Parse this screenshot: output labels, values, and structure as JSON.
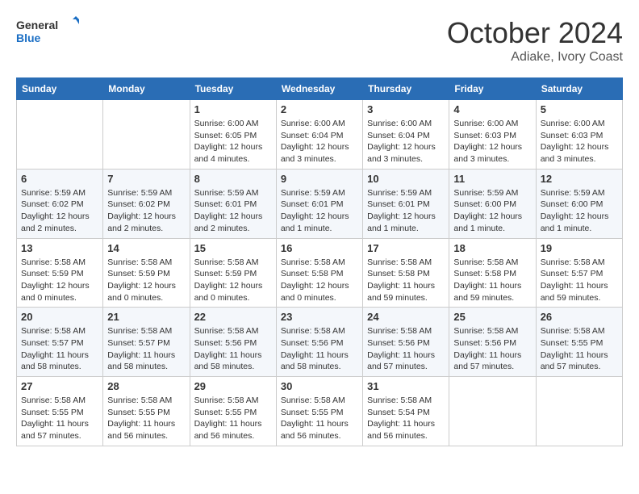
{
  "header": {
    "logo": "GeneralBlue",
    "month": "October 2024",
    "location": "Adiake, Ivory Coast"
  },
  "weekdays": [
    "Sunday",
    "Monday",
    "Tuesday",
    "Wednesday",
    "Thursday",
    "Friday",
    "Saturday"
  ],
  "weeks": [
    [
      null,
      null,
      {
        "day": 1,
        "sunrise": "6:00 AM",
        "sunset": "6:05 PM",
        "daylight": "12 hours and 4 minutes."
      },
      {
        "day": 2,
        "sunrise": "6:00 AM",
        "sunset": "6:04 PM",
        "daylight": "12 hours and 3 minutes."
      },
      {
        "day": 3,
        "sunrise": "6:00 AM",
        "sunset": "6:04 PM",
        "daylight": "12 hours and 3 minutes."
      },
      {
        "day": 4,
        "sunrise": "6:00 AM",
        "sunset": "6:03 PM",
        "daylight": "12 hours and 3 minutes."
      },
      {
        "day": 5,
        "sunrise": "6:00 AM",
        "sunset": "6:03 PM",
        "daylight": "12 hours and 3 minutes."
      }
    ],
    [
      {
        "day": 6,
        "sunrise": "5:59 AM",
        "sunset": "6:02 PM",
        "daylight": "12 hours and 2 minutes."
      },
      {
        "day": 7,
        "sunrise": "5:59 AM",
        "sunset": "6:02 PM",
        "daylight": "12 hours and 2 minutes."
      },
      {
        "day": 8,
        "sunrise": "5:59 AM",
        "sunset": "6:01 PM",
        "daylight": "12 hours and 2 minutes."
      },
      {
        "day": 9,
        "sunrise": "5:59 AM",
        "sunset": "6:01 PM",
        "daylight": "12 hours and 1 minute."
      },
      {
        "day": 10,
        "sunrise": "5:59 AM",
        "sunset": "6:01 PM",
        "daylight": "12 hours and 1 minute."
      },
      {
        "day": 11,
        "sunrise": "5:59 AM",
        "sunset": "6:00 PM",
        "daylight": "12 hours and 1 minute."
      },
      {
        "day": 12,
        "sunrise": "5:59 AM",
        "sunset": "6:00 PM",
        "daylight": "12 hours and 1 minute."
      }
    ],
    [
      {
        "day": 13,
        "sunrise": "5:58 AM",
        "sunset": "5:59 PM",
        "daylight": "12 hours and 0 minutes."
      },
      {
        "day": 14,
        "sunrise": "5:58 AM",
        "sunset": "5:59 PM",
        "daylight": "12 hours and 0 minutes."
      },
      {
        "day": 15,
        "sunrise": "5:58 AM",
        "sunset": "5:59 PM",
        "daylight": "12 hours and 0 minutes."
      },
      {
        "day": 16,
        "sunrise": "5:58 AM",
        "sunset": "5:58 PM",
        "daylight": "12 hours and 0 minutes."
      },
      {
        "day": 17,
        "sunrise": "5:58 AM",
        "sunset": "5:58 PM",
        "daylight": "11 hours and 59 minutes."
      },
      {
        "day": 18,
        "sunrise": "5:58 AM",
        "sunset": "5:58 PM",
        "daylight": "11 hours and 59 minutes."
      },
      {
        "day": 19,
        "sunrise": "5:58 AM",
        "sunset": "5:57 PM",
        "daylight": "11 hours and 59 minutes."
      }
    ],
    [
      {
        "day": 20,
        "sunrise": "5:58 AM",
        "sunset": "5:57 PM",
        "daylight": "11 hours and 58 minutes."
      },
      {
        "day": 21,
        "sunrise": "5:58 AM",
        "sunset": "5:57 PM",
        "daylight": "11 hours and 58 minutes."
      },
      {
        "day": 22,
        "sunrise": "5:58 AM",
        "sunset": "5:56 PM",
        "daylight": "11 hours and 58 minutes."
      },
      {
        "day": 23,
        "sunrise": "5:58 AM",
        "sunset": "5:56 PM",
        "daylight": "11 hours and 58 minutes."
      },
      {
        "day": 24,
        "sunrise": "5:58 AM",
        "sunset": "5:56 PM",
        "daylight": "11 hours and 57 minutes."
      },
      {
        "day": 25,
        "sunrise": "5:58 AM",
        "sunset": "5:56 PM",
        "daylight": "11 hours and 57 minutes."
      },
      {
        "day": 26,
        "sunrise": "5:58 AM",
        "sunset": "5:55 PM",
        "daylight": "11 hours and 57 minutes."
      }
    ],
    [
      {
        "day": 27,
        "sunrise": "5:58 AM",
        "sunset": "5:55 PM",
        "daylight": "11 hours and 57 minutes."
      },
      {
        "day": 28,
        "sunrise": "5:58 AM",
        "sunset": "5:55 PM",
        "daylight": "11 hours and 56 minutes."
      },
      {
        "day": 29,
        "sunrise": "5:58 AM",
        "sunset": "5:55 PM",
        "daylight": "11 hours and 56 minutes."
      },
      {
        "day": 30,
        "sunrise": "5:58 AM",
        "sunset": "5:55 PM",
        "daylight": "11 hours and 56 minutes."
      },
      {
        "day": 31,
        "sunrise": "5:58 AM",
        "sunset": "5:54 PM",
        "daylight": "11 hours and 56 minutes."
      },
      null,
      null
    ]
  ],
  "labels": {
    "sunrise": "Sunrise:",
    "sunset": "Sunset:",
    "daylight": "Daylight:"
  }
}
